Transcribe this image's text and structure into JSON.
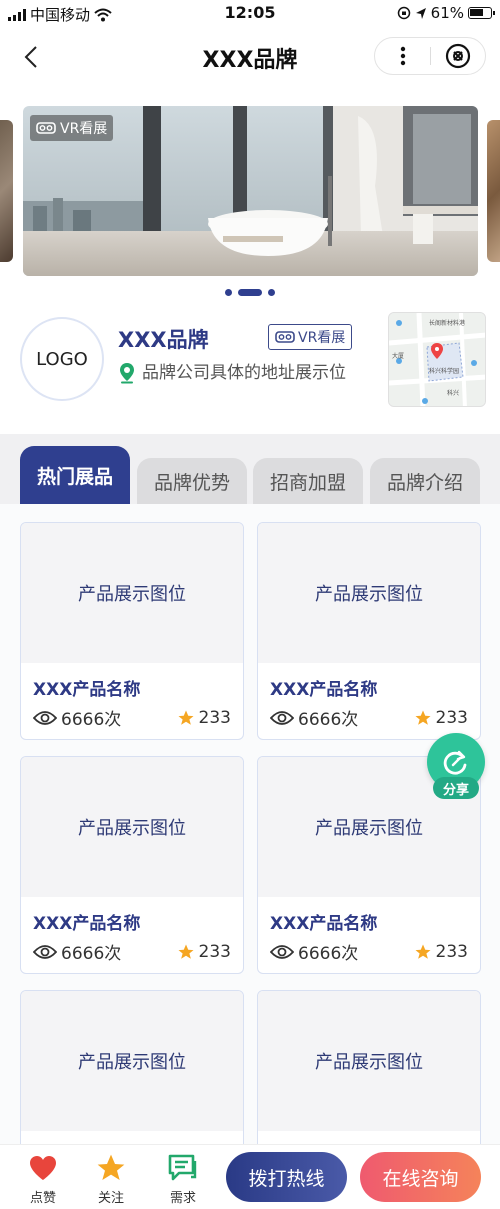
{
  "status_bar": {
    "carrier": "中国移动",
    "time": "12:05",
    "battery": "61%"
  },
  "nav": {
    "title": "XXX品牌"
  },
  "carousel": {
    "vr_label": "VR看展",
    "slide_count": 3,
    "active_index": 1
  },
  "brand": {
    "logo_text": "LOGO",
    "name": "XXX品牌",
    "vr_label": "VR看展",
    "address": "品牌公司具体的地址展示位",
    "map_labels": [
      "长阁新材料港",
      "大厦",
      "科兴科学园",
      "科兴"
    ]
  },
  "tabs": [
    {
      "label": "热门展品",
      "active": true
    },
    {
      "label": "品牌优势",
      "active": false
    },
    {
      "label": "招商加盟",
      "active": false
    },
    {
      "label": "品牌介绍",
      "active": false
    }
  ],
  "products": [
    {
      "image_label": "产品展示图位",
      "name": "XXX产品名称",
      "views": "6666次",
      "stars": "233"
    },
    {
      "image_label": "产品展示图位",
      "name": "XXX产品名称",
      "views": "6666次",
      "stars": "233"
    },
    {
      "image_label": "产品展示图位",
      "name": "XXX产品名称",
      "views": "6666次",
      "stars": "233"
    },
    {
      "image_label": "产品展示图位",
      "name": "XXX产品名称",
      "views": "6666次",
      "stars": "233"
    },
    {
      "image_label": "产品展示图位",
      "name": "",
      "views": "",
      "stars": ""
    },
    {
      "image_label": "产品展示图位",
      "name": "",
      "views": "",
      "stars": ""
    }
  ],
  "share": {
    "label": "分享"
  },
  "bottom_bar": {
    "like_label": "点赞",
    "follow_label": "关注",
    "demand_label": "需求",
    "call_label": "拨打热线",
    "consult_label": "在线咨询"
  },
  "colors": {
    "brand_blue": "#2f3f8f",
    "share_green": "#2ec49a",
    "consult_red": "#ef5a6f",
    "star_orange": "#f5a623"
  }
}
